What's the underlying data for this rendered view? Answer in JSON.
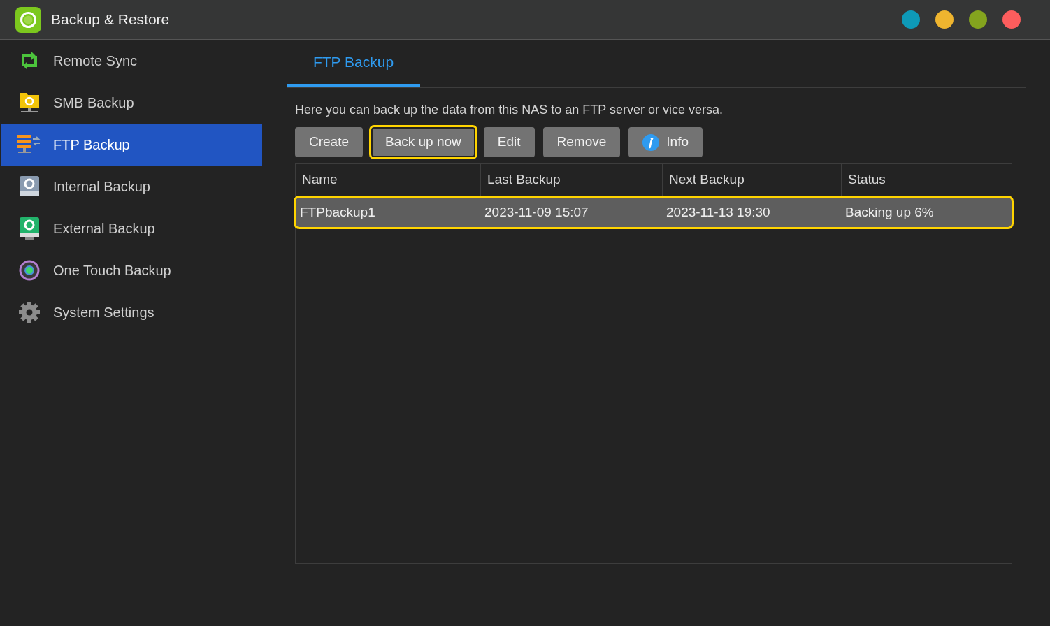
{
  "window": {
    "title": "Backup & Restore",
    "controls": [
      {
        "color": "#0e9ab8"
      },
      {
        "color": "#efb52f"
      },
      {
        "color": "#84a41e"
      },
      {
        "color": "#fd5d5d"
      }
    ]
  },
  "sidebar": {
    "items": [
      {
        "label": "Remote Sync",
        "kind": "sync",
        "selected": false
      },
      {
        "label": "SMB Backup",
        "kind": "folder",
        "selected": false
      },
      {
        "label": "FTP Backup",
        "kind": "server",
        "selected": true
      },
      {
        "label": "Internal Backup",
        "kind": "drive",
        "selected": false
      },
      {
        "label": "External Backup",
        "kind": "external",
        "selected": false
      },
      {
        "label": "One Touch Backup",
        "kind": "touch",
        "selected": false
      },
      {
        "label": "System Settings",
        "kind": "gear",
        "selected": false
      }
    ]
  },
  "tabs": [
    {
      "label": "FTP Backup",
      "selected": true
    }
  ],
  "description": "Here you can back up the data from this NAS to an FTP server or vice versa.",
  "toolbar": [
    {
      "label": "Create",
      "highlighted": false
    },
    {
      "label": "Back up now",
      "highlighted": true
    },
    {
      "label": "Edit",
      "highlighted": false
    },
    {
      "label": "Remove",
      "highlighted": false
    },
    {
      "label": "Info",
      "highlighted": false,
      "kind": "info"
    }
  ],
  "table": {
    "columns": [
      "Name",
      "Last Backup",
      "Next Backup",
      "Status"
    ],
    "rows": [
      {
        "cells": [
          "FTPbackup1",
          "2023-11-09 15:07",
          "2023-11-13 19:30",
          "Backing up 6%"
        ],
        "selected": true,
        "highlighted": true
      }
    ]
  }
}
